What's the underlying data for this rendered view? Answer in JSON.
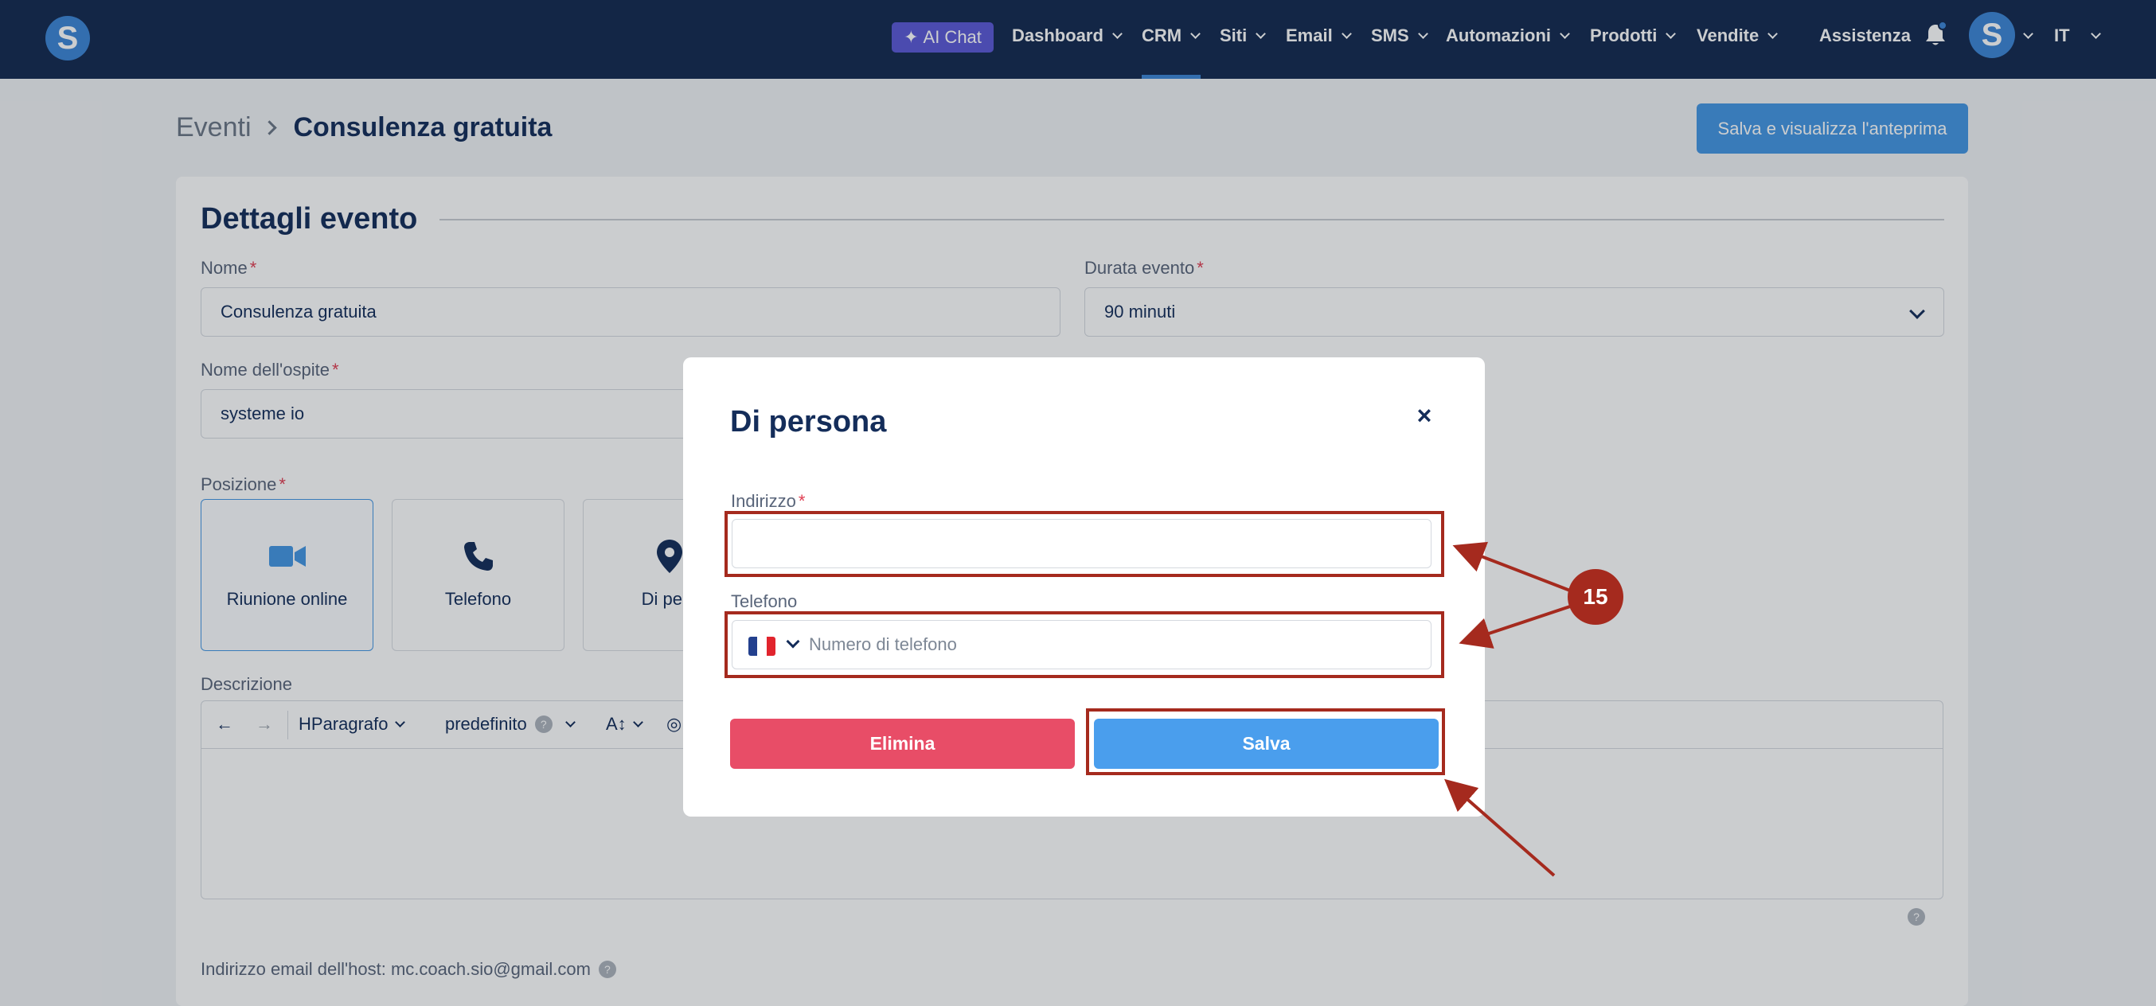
{
  "navbar": {
    "ai_chat": "AI Chat",
    "items": [
      "Dashboard",
      "CRM",
      "Siti",
      "Email",
      "SMS",
      "Automazioni",
      "Prodotti",
      "Vendite"
    ],
    "assistance": "Assistenza",
    "language": "IT",
    "avatar_letter": "S",
    "logo_letter": "S",
    "active_item": "CRM"
  },
  "breadcrumb": {
    "root": "Eventi",
    "current": "Consulenza gratuita"
  },
  "header": {
    "preview_button": "Salva e visualizza l'anteprima"
  },
  "event_details": {
    "title": "Dettagli evento",
    "name_label": "Nome",
    "name_value": "Consulenza gratuita",
    "duration_label": "Durata evento",
    "duration_value": "90 minuti",
    "host_label": "Nome dell'ospite",
    "host_value": "systeme io",
    "position_label": "Posizione",
    "positions": [
      "Riunione online",
      "Telefono",
      "Di pers"
    ],
    "description_label": "Descrizione",
    "toolbar": {
      "paragraph": "Paragrafo",
      "font": "predefinito",
      "size_glyph": "A↕"
    },
    "host_email_text": "Indirizzo email dell'host: mc.coach.sio@gmail.com"
  },
  "modal": {
    "title": "Di persona",
    "close": "×",
    "address_label": "Indirizzo",
    "address_value": "",
    "phone_label": "Telefono",
    "phone_placeholder": "Numero di telefono",
    "delete_button": "Elimina",
    "save_button": "Salva"
  },
  "annotation": {
    "step_number": "15"
  },
  "colors": {
    "navbar": "#142a50",
    "accent": "#4496e3",
    "danger": "#e84d67",
    "annotation": "#a52a1e"
  }
}
